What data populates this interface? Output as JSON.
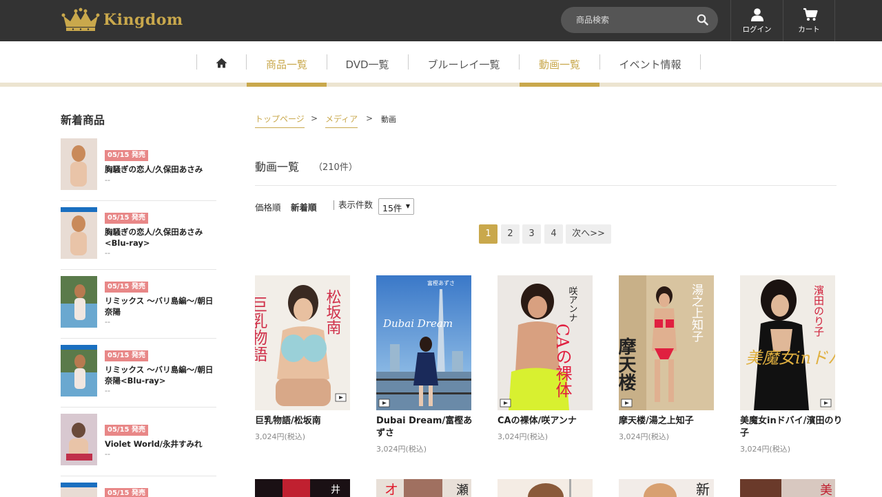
{
  "header": {
    "brand": "Kingdom",
    "search_placeholder": "商品検索",
    "login_label": "ログイン",
    "cart_label": "カート",
    "accent_color": "#c9a84c"
  },
  "nav": {
    "items": [
      {
        "label": "商品一覧"
      },
      {
        "label": "DVD一覧"
      },
      {
        "label": "ブルーレイ一覧"
      },
      {
        "label": "動画一覧"
      },
      {
        "label": "イベント情報"
      }
    ]
  },
  "sidebar": {
    "title": "新着商品",
    "items": [
      {
        "date": "05/15 発売",
        "name": "胸騒ぎの恋人/久保田あさみ",
        "price": "--"
      },
      {
        "date": "05/15 発売",
        "name": "胸騒ぎの恋人/久保田あさみ<Blu-ray>",
        "price": "--"
      },
      {
        "date": "05/15 発売",
        "name": "リミックス ～バリ島編～/朝日奈陽",
        "price": "--"
      },
      {
        "date": "05/15 発売",
        "name": "リミックス ～バリ島編～/朝日奈陽<Blu-ray>",
        "price": "--"
      },
      {
        "date": "05/15 発売",
        "name": "Violet World/永井すみれ",
        "price": "--"
      },
      {
        "date": "05/15 発売"
      }
    ]
  },
  "breadcrumb": {
    "top": "トップページ",
    "media": "メディア",
    "current": "動画",
    "separator": ">"
  },
  "main": {
    "title": "動画一覧",
    "count": "（210件）",
    "sort_price": "価格順",
    "sort_new": "新着順",
    "per_page_label": "表示件数",
    "per_page_value": "15件",
    "pages": [
      "1",
      "2",
      "3",
      "4",
      "次へ>>"
    ]
  },
  "products": [
    {
      "title": "巨乳物語/松坂南",
      "price": "3,024円(税込)",
      "cover_text": "巨乳物語",
      "cover_name": "松坂南"
    },
    {
      "title": "Dubai Dream/富樫あずさ",
      "price": "3,024円(税込)",
      "cover_text": "Dubai Dream",
      "cover_name": "富樫あずさ"
    },
    {
      "title": "CAの裸体/咲アンナ",
      "price": "3,024円(税込)",
      "cover_text": "CAの裸体",
      "cover_name": "咲アンナ"
    },
    {
      "title": "摩天楼/湯之上知子",
      "price": "3,024円(税込)",
      "cover_text": "摩天楼",
      "cover_name": "湯之上知子"
    },
    {
      "title": "美魔女inドバイ/濱田のり子",
      "price": "3,024円(税込)",
      "cover_text": "美魔女inドバイ",
      "cover_name": "濱田のり子"
    }
  ],
  "row2_cover_text": [
    "井",
    "オ",
    "瀬",
    "新",
    "美"
  ]
}
